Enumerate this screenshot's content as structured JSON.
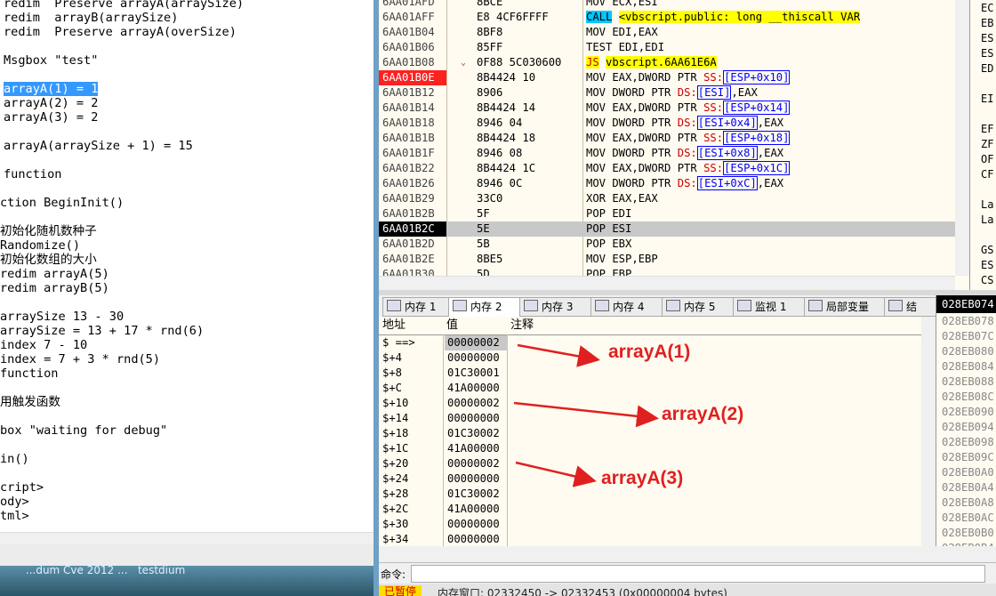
{
  "editor": {
    "lines": [
      "redim  Preserve arrayA(arraySize)",
      "redim  arrayB(arraySize)",
      "redim  Preserve arrayA(overSize)",
      "",
      "Msgbox \"test\"",
      "",
      "arrayA(1) = 1",
      "arrayA(2) = 2",
      "arrayA(3) = 2",
      "",
      "arrayA(arraySize + 1) = 15",
      "",
      "function",
      "",
      "ction BeginInit()",
      "",
      "初始化随机数种子",
      "Randomize()",
      "初始化数组的大小",
      "redim arrayA(5)",
      "redim arrayB(5)",
      "",
      "arraySize 13 - 30",
      "arraySize = 13 + 17 * rnd(6)",
      "index 7 - 10",
      "index = 7 + 3 * rnd(5)",
      "function",
      "",
      "用触发函数",
      "",
      "box \"waiting for debug\"",
      "",
      "in()",
      "",
      "cript>",
      "ody>",
      "tml>"
    ],
    "selected_text": "arrayA(1) = 1"
  },
  "taskbar": {
    "text": "      ...dum Cve 2012 ...   testdium"
  },
  "disasm": {
    "rows": [
      {
        "addr": "6AA01AFD",
        "bytes": "8BCE",
        "asm": "MOV ECX,ESI"
      },
      {
        "addr": "6AA01AFF",
        "bytes": "E8 4CF6FFFF",
        "op": "CALL",
        "target": "<vbscript.public: long __thiscall VAR"
      },
      {
        "addr": "6AA01B04",
        "bytes": "8BF8",
        "asm": "MOV EDI,EAX"
      },
      {
        "addr": "6AA01B06",
        "bytes": "85FF",
        "asm": "TEST EDI,EDI"
      },
      {
        "addr": "6AA01B08",
        "bytes": "0F88 5C030600",
        "op": "JS",
        "target": "vbscript.6AA61E6A"
      },
      {
        "addr": "6AA01B0E",
        "bytes": "8B4424 10",
        "pre": "MOV EAX,DWORD PTR ",
        "seg": "SS:",
        "mem": "[ESP+0x10]"
      },
      {
        "addr": "6AA01B12",
        "bytes": "8906",
        "pre": "MOV DWORD PTR ",
        "seg": "DS:",
        "mem": "[ESI]",
        "post": ",EAX"
      },
      {
        "addr": "6AA01B14",
        "bytes": "8B4424 14",
        "pre": "MOV EAX,DWORD PTR ",
        "seg": "SS:",
        "mem": "[ESP+0x14]"
      },
      {
        "addr": "6AA01B18",
        "bytes": "8946 04",
        "pre": "MOV DWORD PTR ",
        "seg": "DS:",
        "mem": "[ESI+0x4]",
        "post": ",EAX"
      },
      {
        "addr": "6AA01B1B",
        "bytes": "8B4424 18",
        "pre": "MOV EAX,DWORD PTR ",
        "seg": "SS:",
        "mem": "[ESP+0x18]"
      },
      {
        "addr": "6AA01B1F",
        "bytes": "8946 08",
        "pre": "MOV DWORD PTR ",
        "seg": "DS:",
        "mem": "[ESI+0x8]",
        "post": ",EAX"
      },
      {
        "addr": "6AA01B22",
        "bytes": "8B4424 1C",
        "pre": "MOV EAX,DWORD PTR ",
        "seg": "SS:",
        "mem": "[ESP+0x1C]"
      },
      {
        "addr": "6AA01B26",
        "bytes": "8946 0C",
        "pre": "MOV DWORD PTR ",
        "seg": "DS:",
        "mem": "[ESI+0xC]",
        "post": ",EAX"
      },
      {
        "addr": "6AA01B29",
        "bytes": "33C0",
        "asm": "XOR EAX,EAX"
      },
      {
        "addr": "6AA01B2B",
        "bytes": "5F",
        "asm": "POP EDI"
      },
      {
        "addr": "6AA01B2C",
        "bytes": "5E",
        "asm": "POP ESI"
      },
      {
        "addr": "6AA01B2D",
        "bytes": "5B",
        "asm": "POP EBX"
      },
      {
        "addr": "6AA01B2E",
        "bytes": "8BE5",
        "asm": "MOV ESP,EBP"
      },
      {
        "addr": "6AA01B30",
        "bytes": "5D",
        "asm": "POP EBP"
      }
    ],
    "breakpoint_addr": "6AA01B0E",
    "current_addr": "6AA01B2C",
    "jump_addr": "6AA01B08"
  },
  "registers": [
    "EC",
    "EB",
    "ES",
    "ES",
    "ED",
    "",
    "EI",
    "",
    "EF",
    "ZF",
    "OF",
    "CF",
    "",
    "La",
    "La",
    "",
    "GS",
    "ES",
    "CS"
  ],
  "tabs": [
    {
      "label": "内存 1"
    },
    {
      "label": "内存 2"
    },
    {
      "label": "内存 3"
    },
    {
      "label": "内存 4"
    },
    {
      "label": "内存 5"
    },
    {
      "label": "监视 1"
    },
    {
      "label": "局部变量"
    },
    {
      "label": "结"
    }
  ],
  "active_tab": "内存 2",
  "memory": {
    "headers": {
      "addr": "地址",
      "value": "值",
      "comment": "注释"
    },
    "rows": [
      {
        "off": "$ ==>",
        "val": "00000002"
      },
      {
        "off": "$+4",
        "val": "00000000"
      },
      {
        "off": "$+8",
        "val": "01C30001"
      },
      {
        "off": "$+C",
        "val": "41A00000"
      },
      {
        "off": "$+10",
        "val": "00000002"
      },
      {
        "off": "$+14",
        "val": "00000000"
      },
      {
        "off": "$+18",
        "val": "01C30002"
      },
      {
        "off": "$+1C",
        "val": "41A00000"
      },
      {
        "off": "$+20",
        "val": "00000002"
      },
      {
        "off": "$+24",
        "val": "00000000"
      },
      {
        "off": "$+28",
        "val": "01C30002"
      },
      {
        "off": "$+2C",
        "val": "41A00000"
      },
      {
        "off": "$+30",
        "val": "00000000"
      },
      {
        "off": "$+34",
        "val": "00000000"
      }
    ],
    "annotations": [
      "arrayA(1)",
      "arrayA(2)",
      "arrayA(3)"
    ]
  },
  "stack": {
    "header": "028EB074",
    "rows": [
      "028EB078",
      "028EB07C",
      "028EB080",
      "028EB084",
      "028EB088",
      "028EB08C",
      "028EB090",
      "028EB094",
      "028EB098",
      "028EB09C",
      "028EB0A0",
      "028EB0A4",
      "028EB0A8",
      "028EB0AC",
      "028EB0B0",
      "028EB0B4"
    ]
  },
  "command": {
    "label": "命令:",
    "value": ""
  },
  "status": {
    "badge": "已暂停",
    "text": "内存窗口: 02332450 -> 02332453 (0x00000004 bytes)"
  },
  "colors": {
    "accent": "#e02020",
    "breakpoint": "#ff2020",
    "call": "#00c8ff",
    "jump": "#ffff00",
    "pane_bg": "#fffbf0"
  }
}
